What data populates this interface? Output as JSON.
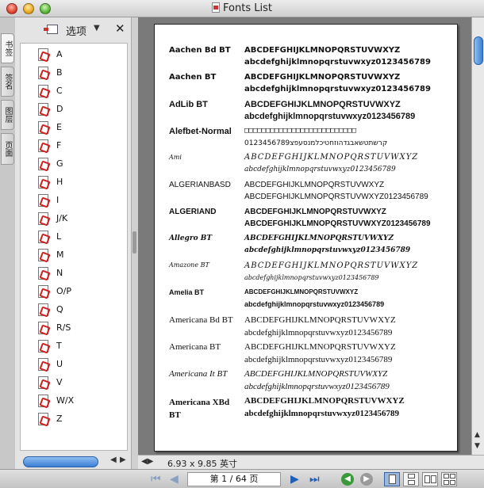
{
  "window": {
    "title": "Fonts List"
  },
  "left_tabs": [
    "书签",
    "签名",
    "图层",
    "页面"
  ],
  "sidebar": {
    "options_label": "选项",
    "items": [
      "A",
      "B",
      "C",
      "D",
      "E",
      "F",
      "G",
      "H",
      "I",
      "J/K",
      "L",
      "M",
      "N",
      "O/P",
      "Q",
      "R/S",
      "T",
      "U",
      "V",
      "W/X",
      "Z"
    ]
  },
  "document": {
    "fonts": [
      {
        "name": "Aachen Bd BT",
        "upper": "ABCDEFGHIJKLMNOPQRSTUVWXYZ",
        "lower": "abcdefghijklmnopqrstuvwxyz0123456789"
      },
      {
        "name": "Aachen BT",
        "upper": "ABCDEFGHIJKLMNOPQRSTUVWXYZ",
        "lower": "abcdefghijklmnopqrstuvwxyz0123456789"
      },
      {
        "name": "AdLib BT",
        "upper": "ABCDEFGHIJKLMNOPQRSTUVWXYZ",
        "lower": "abcdefghijklmnopqrstuvwxyz0123456789"
      },
      {
        "name": "Alefbet-Normal",
        "upper": "□□□□□□□□□□□□□□□□□□□□□□□□□□",
        "lower": "קרשתטשאבגדהוזחטיכלמנסעפצ0123456789"
      },
      {
        "name": "Ami",
        "upper": "ABCDEFGHIJKLMNOPQRSTUVWXYZ",
        "lower": "abcdefghijklmnopqrstuvwxyz0123456789"
      },
      {
        "name": "ALGERIANBASD",
        "upper": "ABCDEFGHIJKLMNOPQRSTUVWXYZ",
        "lower": "ABCDEFGHIJKLMNOPQRSTUVWXYZ0123456789"
      },
      {
        "name": "ALGERIAND",
        "upper": "ABCDEFGHIJKLMNOPQRSTUVWXYZ",
        "lower": "ABCDEFGHIJKLMNOPQRSTUVWXYZ0123456789"
      },
      {
        "name": "Allegro BT",
        "upper": "ABCDEFGHIJKLMNOPQRSTUVWXYZ",
        "lower": "abcdefghijklmnopqrstuvwxyz0123456789"
      },
      {
        "name": "Amazone BT",
        "upper": "ABCDEFGHIJKLMNOPQRSTUVWXYZ",
        "lower": "abcdefghijklmnopqrstuvwxyz0123456789"
      },
      {
        "name": "Amelia BT",
        "upper": "ABCDEFGHIJKLMNOPQRSTUVWXYZ",
        "lower": "abcdefghijklmnopqrstuvwxyz0123456789"
      },
      {
        "name": "Americana Bd BT",
        "upper": "ABCDEFGHIJKLMNOPQRSTUVWXYZ",
        "lower": "abcdefghijklmnopqrstuvwxyz0123456789"
      },
      {
        "name": "Americana BT",
        "upper": "ABCDEFGHIJKLMNOPQRSTUVWXYZ",
        "lower": "abcdefghijklmnopqrstuvwxyz0123456789"
      },
      {
        "name": "Americana It BT",
        "upper": "ABCDEFGHIJKLMNOPQRSTUVWXYZ",
        "lower": "abcdefghijklmnopqrstuvwxyz0123456789"
      },
      {
        "name": "Americana XBd BT",
        "upper": "ABCDEFGHIJKLMNOPQRSTUVWXYZ",
        "lower": "abcdefghijklmnopqrstuvwxyz0123456789"
      }
    ]
  },
  "status": {
    "page_size": "6.93 x 9.85 英寸"
  },
  "toolbar": {
    "page_indicator": "第 1 / 64 页"
  },
  "colors": {
    "accent_blue": "#3a7fd5",
    "pdf_red": "#c22222",
    "nav_green": "#3a9a3a"
  }
}
